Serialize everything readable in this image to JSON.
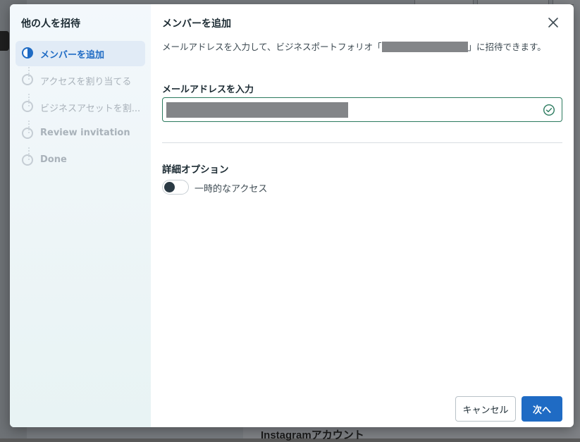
{
  "background": {
    "partial_text": "Instagramアカウント"
  },
  "sidebar": {
    "title": "他の人を招待",
    "steps": [
      {
        "label": "メンバーを追加",
        "state": "active"
      },
      {
        "label": "アクセスを割り当てる",
        "state": "pending"
      },
      {
        "label": "ビジネスアセットを割...",
        "state": "pending"
      },
      {
        "label": "Review invitation",
        "state": "pending"
      },
      {
        "label": "Done",
        "state": "pending"
      }
    ]
  },
  "main": {
    "title": "メンバーを追加",
    "description_before": "メールアドレスを入力して、ビジネスポートフォリオ「",
    "description_after": "」に招待できます。",
    "email_label": "メールアドレスを入力",
    "email_value": "",
    "email_valid_icon": "check-circle-icon",
    "advanced_title": "詳細オプション",
    "temporary_access_label": "一時的なアクセス",
    "temporary_access_enabled": false
  },
  "footer": {
    "cancel_label": "キャンセル",
    "next_label": "次へ"
  },
  "colors": {
    "accent": "#1f6bc4",
    "valid_border": "#2b7a5e"
  }
}
